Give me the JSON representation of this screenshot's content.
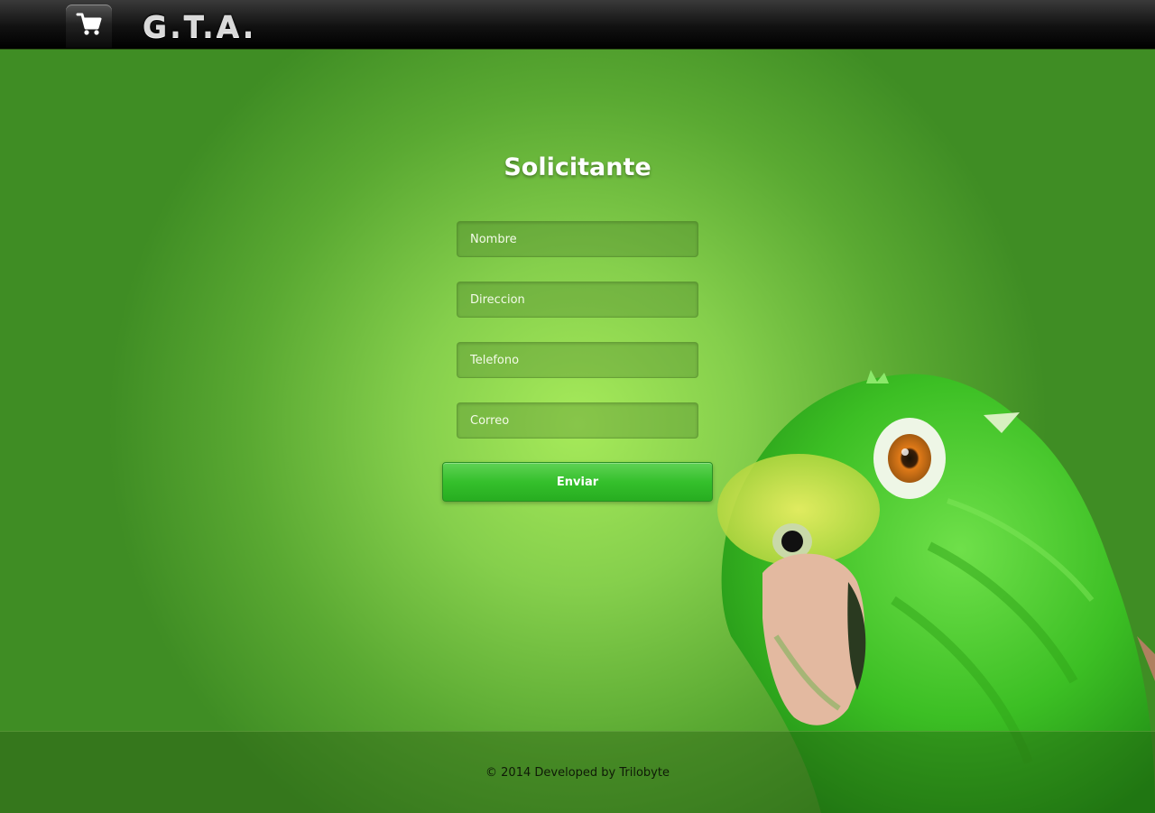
{
  "header": {
    "cart_icon": "shopping-cart-icon",
    "brand": "G.T.A."
  },
  "form": {
    "title": "Solicitante",
    "fields": {
      "nombre": {
        "placeholder": "Nombre",
        "value": ""
      },
      "direccion": {
        "placeholder": "Direccion",
        "value": ""
      },
      "telefono": {
        "placeholder": "Telefono",
        "value": ""
      },
      "correo": {
        "placeholder": "Correo",
        "value": ""
      }
    },
    "submit_label": "Enviar"
  },
  "footer": {
    "text": "© 2014 Developed by Trilobyte"
  },
  "colors": {
    "background_light": "#a6ea5a",
    "background_dark": "#3f8d24",
    "button_green": "#35c02c",
    "topbar": "#000000"
  }
}
